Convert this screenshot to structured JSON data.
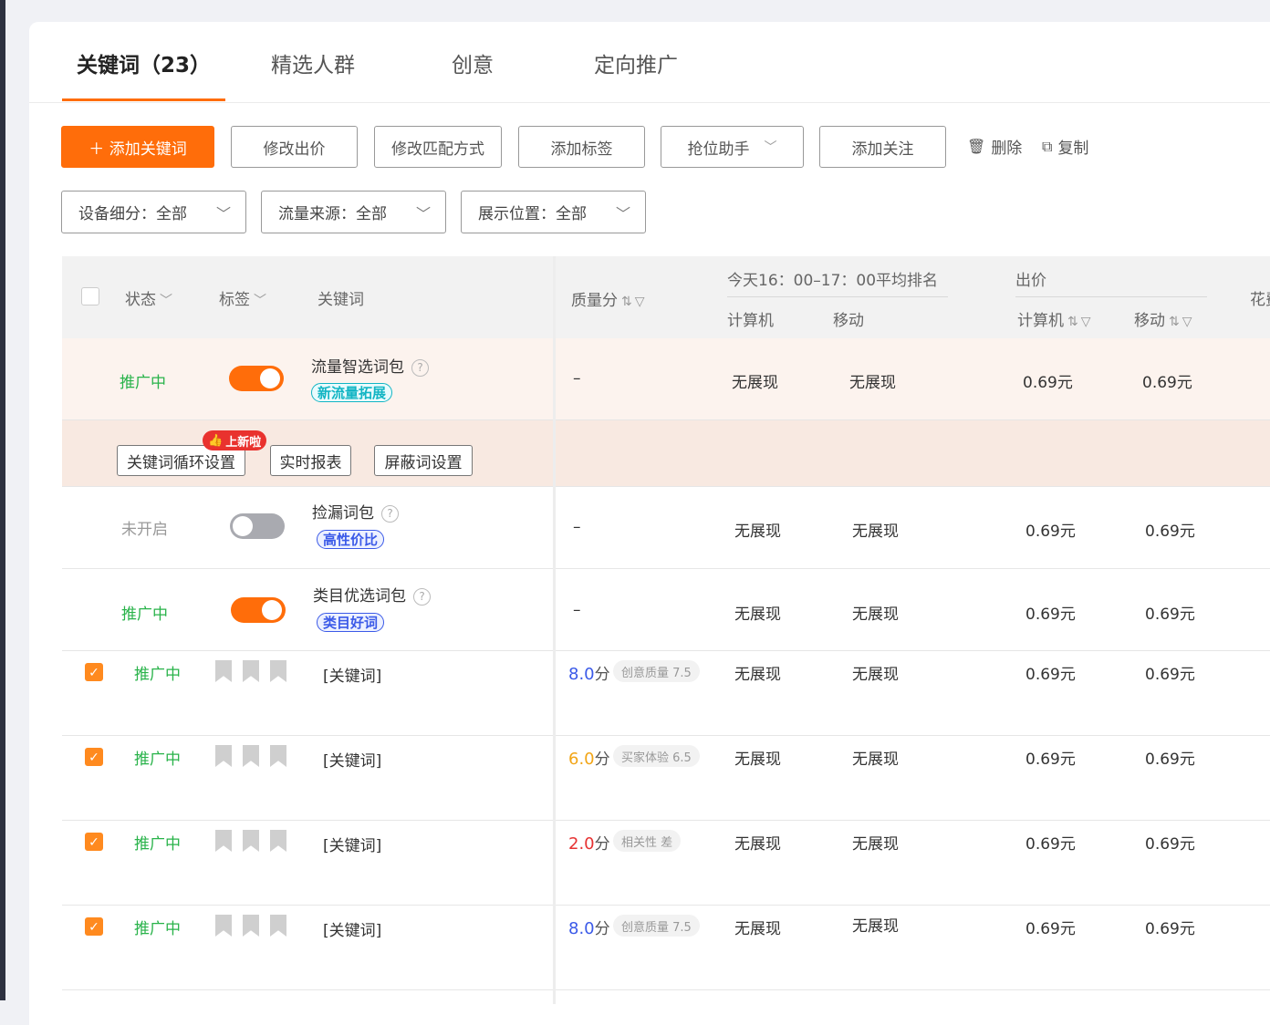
{
  "tabs": [
    {
      "label": "关键词（23）",
      "active": true
    },
    {
      "label": "精选人群"
    },
    {
      "label": "创意"
    },
    {
      "label": "定向推广"
    }
  ],
  "toolbar": {
    "add_keyword": "＋ 添加关键词",
    "modify_bid": "修改出价",
    "modify_match": "修改匹配方式",
    "add_tag": "添加标签",
    "rank_assistant": "抢位助手",
    "add_follow": "添加关注",
    "delete": "删除",
    "copy": "复制"
  },
  "filters": {
    "device": "设备细分：全部",
    "source": "流量来源：全部",
    "position": "展示位置：全部"
  },
  "table": {
    "headers": {
      "status": "状态",
      "tag": "标签",
      "keyword": "关键词",
      "quality": "质量分",
      "rank_group": "今天16：00–17：00平均排名",
      "rank_pc": "计算机",
      "rank_mobile": "移动",
      "bid_group": "出价",
      "bid_pc": "计算机",
      "bid_mobile": "移动",
      "spend": "花费"
    },
    "packages": [
      {
        "status": "推广中",
        "name": "流量智选词包",
        "tag": "新流量拓展",
        "quality": "–",
        "rank_pc": "无展现",
        "rank_mobile": "无展现",
        "bid_pc": "0.69元",
        "bid_mobile": "0.69元"
      },
      {
        "status": "未开启",
        "name": "捡漏词包",
        "tag": "高性价比",
        "quality": "–",
        "rank_pc": "无展现",
        "rank_mobile": "无展现",
        "bid_pc": "0.69元",
        "bid_mobile": "0.69元"
      },
      {
        "status": "推广中",
        "name": "类目优选词包",
        "tag": "类目好词",
        "quality": "–",
        "rank_pc": "无展现",
        "rank_mobile": "无展现",
        "bid_pc": "0.69元",
        "bid_mobile": "0.69元"
      }
    ],
    "sub_actions": {
      "loop_setting": "关键词循环设置",
      "new_badge": "上新啦",
      "realtime_report": "实时报表",
      "block_words": "屏蔽词设置"
    },
    "keywords": [
      {
        "status": "推广中",
        "keyword": "[关键词]",
        "score": "8.0",
        "unit": "分",
        "score_color": "#3b5ae8",
        "quality_note": "创意质量 7.5",
        "rank_pc": "无展现",
        "rank_mobile": "无展现",
        "bid_pc": "0.69元",
        "bid_mobile": "0.69元"
      },
      {
        "status": "推广中",
        "keyword": "[关键词]",
        "score": "6.0",
        "unit": "分",
        "score_color": "#f2a516",
        "quality_note": "买家体验 6.5",
        "rank_pc": "无展现",
        "rank_mobile": "无展现",
        "bid_pc": "0.69元",
        "bid_mobile": "0.69元"
      },
      {
        "status": "推广中",
        "keyword": "[关键词]",
        "score": "2.0",
        "unit": "分",
        "score_color": "#e63232",
        "quality_note": "相关性 差",
        "rank_pc": "无展现",
        "rank_mobile": "无展现",
        "bid_pc": "0.69元",
        "bid_mobile": "0.69元"
      },
      {
        "status": "推广中",
        "keyword": "[关键词]",
        "score": "8.0",
        "unit": "分",
        "score_color": "#3b5ae8",
        "quality_note": "创意质量 7.5",
        "rank_pc": "无展现",
        "rank_mobile": "无展现",
        "bid_pc": "0.69元",
        "bid_mobile": "0.69元"
      }
    ]
  },
  "colors": {
    "accent": "#ff6d0a",
    "status_on": "#29b34a",
    "status_off": "#999999"
  }
}
